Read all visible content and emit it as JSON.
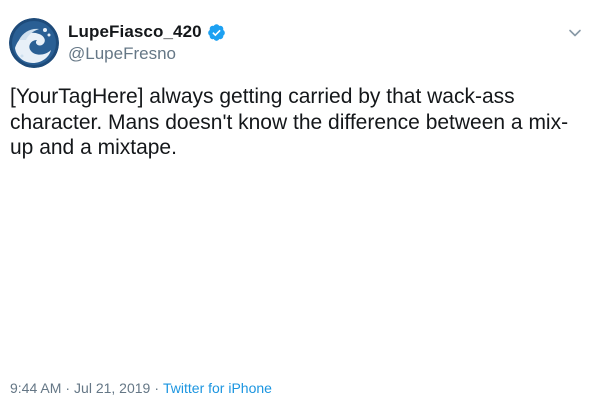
{
  "tweet": {
    "author": {
      "display_name": "LupeFiasco_420",
      "handle": "@LupeFresno",
      "verified": true,
      "avatar": "wave-logo-avatar"
    },
    "menu_icon": "chevron-down-icon",
    "text": "[YourTagHere] always getting carried by that wack-ass character. Mans doesn't know the difference between a mix-up and a mixtape.",
    "time": "9:44 AM",
    "separator": "·",
    "date": "Jul 21, 2019",
    "source": "Twitter for iPhone"
  },
  "colors": {
    "text": "#14171a",
    "secondary": "#657786",
    "link": "#1b95e0",
    "verified": "#1da1f2",
    "avatar_bg": "#1e4b7a"
  }
}
